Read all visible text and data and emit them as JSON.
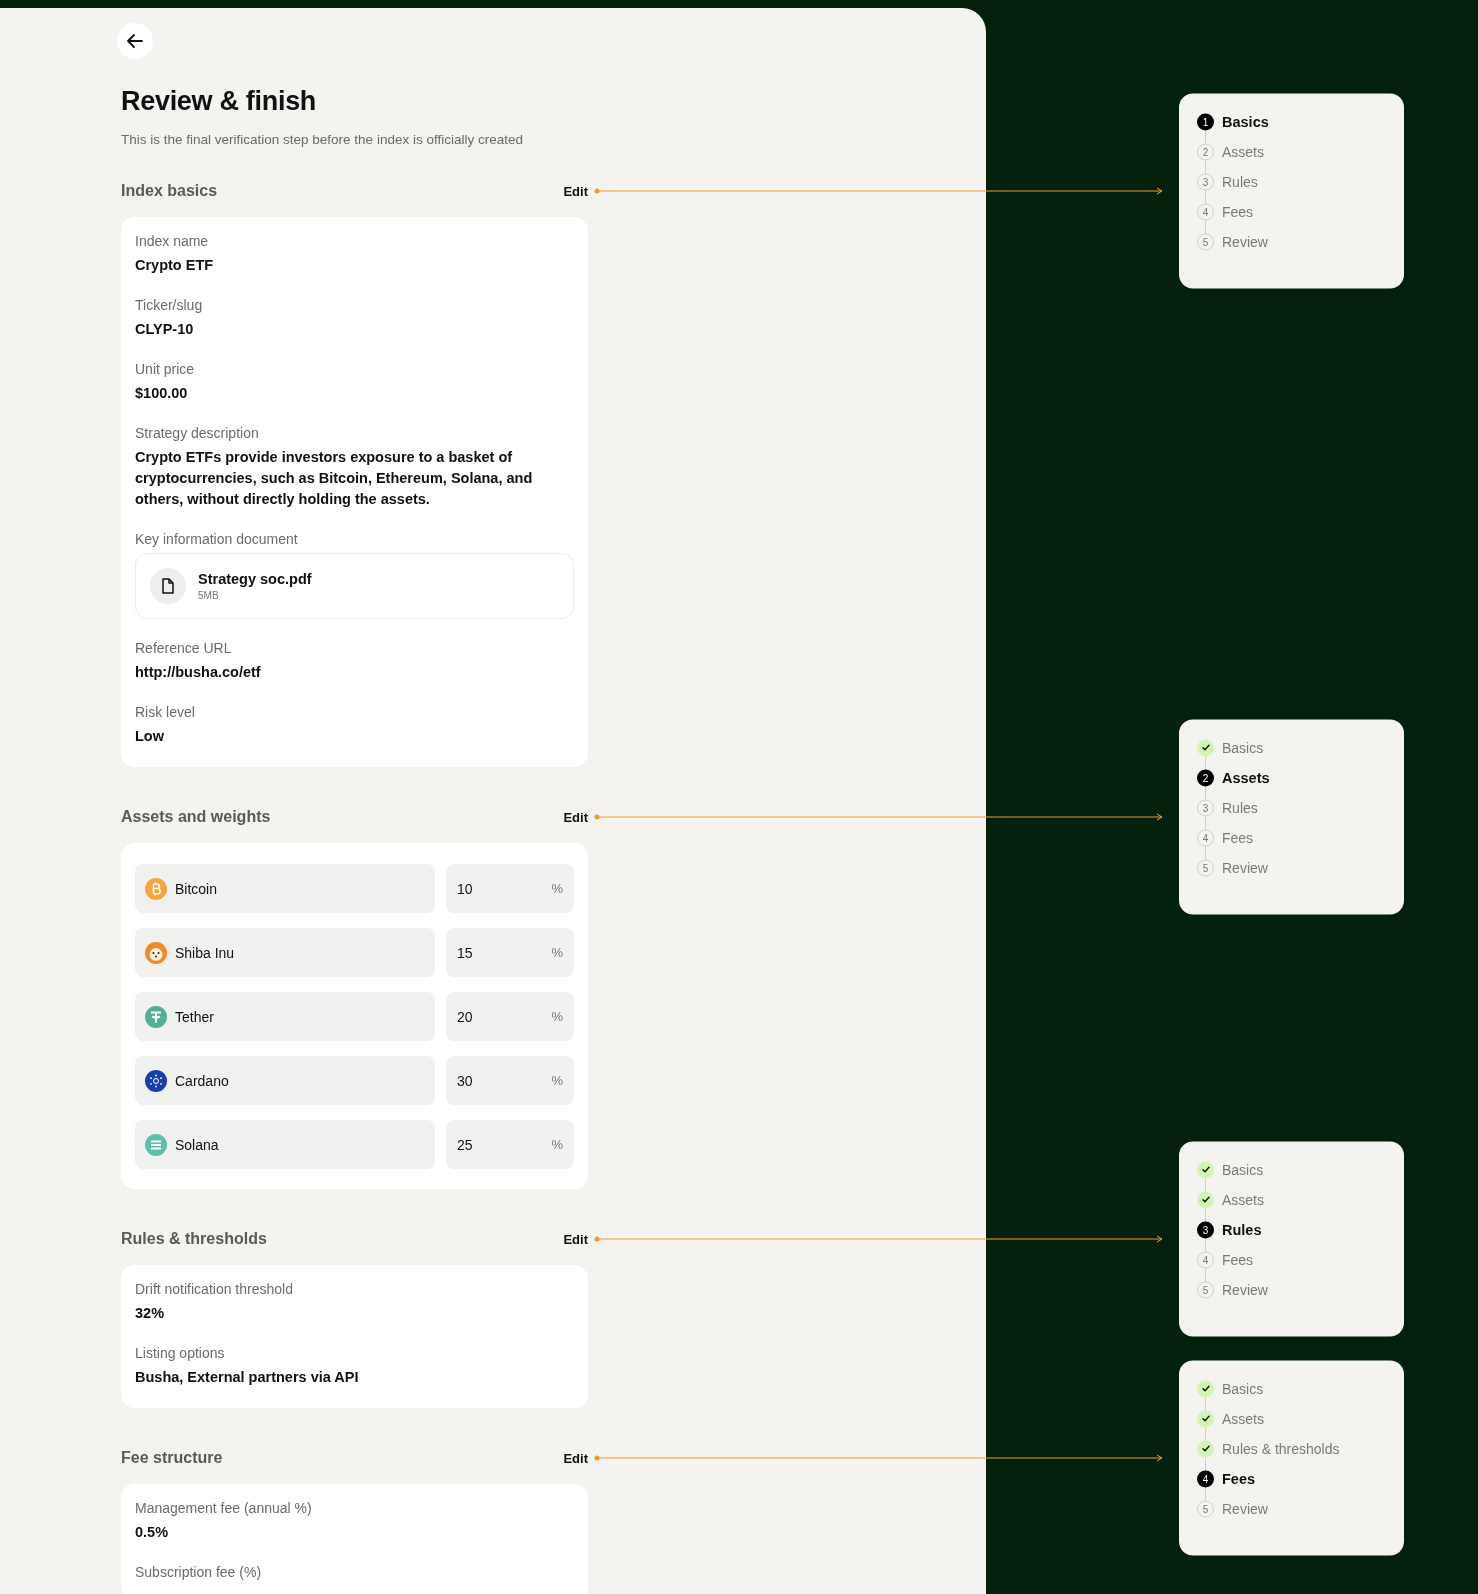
{
  "title": "Review & finish",
  "subtitle": "This is the final verification step before the index is officially created",
  "sections": [
    {
      "kind": "fields",
      "title": "Index basics",
      "edit": "Edit",
      "fields": [
        {
          "kind": "text",
          "label": "Index name",
          "value": "Crypto ETF"
        },
        {
          "kind": "text",
          "label": "Ticker/slug",
          "value": "CLYP-10"
        },
        {
          "kind": "text",
          "label": "Unit price",
          "value": "$100.00"
        },
        {
          "kind": "text",
          "label": "Strategy description",
          "value": "Crypto ETFs provide investors exposure to a basket of cryptocurrencies, such as Bitcoin, Ethereum, Solana, and others, without directly holding the assets."
        },
        {
          "kind": "file",
          "label": "Key information document",
          "file_name": "Strategy soc.pdf",
          "file_size": "5MB"
        },
        {
          "kind": "text",
          "label": "Reference URL",
          "value": "http://busha.co/etf"
        },
        {
          "kind": "text",
          "label": "Risk level",
          "value": "Low"
        }
      ],
      "progress": [
        {
          "label": "Basics",
          "number": "1",
          "done": false,
          "selected": true
        },
        {
          "label": "Assets",
          "number": "2",
          "done": false,
          "selected": false
        },
        {
          "label": "Rules",
          "number": "3",
          "done": false,
          "selected": false
        },
        {
          "label": "Fees",
          "number": "4",
          "done": false,
          "selected": false
        },
        {
          "label": "Review",
          "number": "5",
          "done": false,
          "selected": false
        }
      ]
    },
    {
      "kind": "assets",
      "title": "Assets and weights",
      "edit": "Edit",
      "assets": [
        {
          "name": "Bitcoin",
          "weight": "10",
          "unit": "%",
          "kind": "bitcoin",
          "color": "#f7a440"
        },
        {
          "name": "Shiba Inu",
          "weight": "15",
          "unit": "%",
          "kind": "shiba",
          "color": "#f08a24"
        },
        {
          "name": "Tether",
          "weight": "20",
          "unit": "%",
          "kind": "tether",
          "color": "#50af95"
        },
        {
          "name": "Cardano",
          "weight": "30",
          "unit": "%",
          "kind": "cardano",
          "color": "#1b3faa"
        },
        {
          "name": "Solana",
          "weight": "25",
          "unit": "%",
          "kind": "solana",
          "color": "#5bbfae"
        }
      ],
      "progress": [
        {
          "label": "Basics",
          "done": true,
          "selected": false
        },
        {
          "label": "Assets",
          "number": "2",
          "done": false,
          "selected": true
        },
        {
          "label": "Rules",
          "number": "3",
          "done": false,
          "selected": false
        },
        {
          "label": "Fees",
          "number": "4",
          "done": false,
          "selected": false
        },
        {
          "label": "Review",
          "number": "5",
          "done": false,
          "selected": false
        }
      ]
    },
    {
      "kind": "fields",
      "title": "Rules & thresholds",
      "edit": "Edit",
      "fields": [
        {
          "kind": "text",
          "label": "Drift notification threshold",
          "value": "32%"
        },
        {
          "kind": "text",
          "label": "Listing options",
          "value": "Busha, External partners via API"
        }
      ],
      "progress": [
        {
          "label": "Basics",
          "done": true,
          "selected": false
        },
        {
          "label": "Assets",
          "done": true,
          "selected": false
        },
        {
          "label": "Rules",
          "number": "3",
          "done": false,
          "selected": true
        },
        {
          "label": "Fees",
          "number": "4",
          "done": false,
          "selected": false
        },
        {
          "label": "Review",
          "number": "5",
          "done": false,
          "selected": false
        }
      ]
    },
    {
      "kind": "fields",
      "title": "Fee structure",
      "edit": "Edit",
      "fields": [
        {
          "kind": "text",
          "label": "Management fee (annual %)",
          "value": "0.5%"
        },
        {
          "kind": "label",
          "label": "Subscription fee (%)"
        }
      ],
      "progress": [
        {
          "label": "Basics",
          "done": true,
          "selected": false
        },
        {
          "label": "Assets",
          "done": true,
          "selected": false
        },
        {
          "label": "Rules & thresholds",
          "done": true,
          "selected": false
        },
        {
          "label": "Fees",
          "number": "4",
          "done": false,
          "selected": true
        },
        {
          "label": "Review",
          "number": "5",
          "done": false,
          "selected": false
        }
      ]
    }
  ]
}
